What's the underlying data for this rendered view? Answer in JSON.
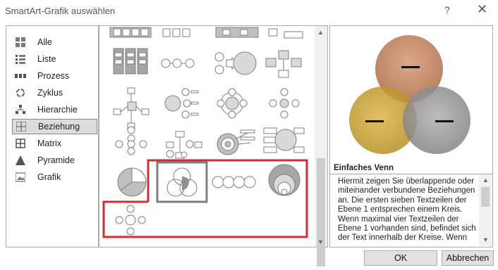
{
  "window": {
    "title": "SmartArt-Grafik auswählen",
    "help_icon": "?",
    "close_icon": "✕"
  },
  "categories": [
    {
      "label": "Alle",
      "icon": "all-icon",
      "selected": false
    },
    {
      "label": "Liste",
      "icon": "list-icon",
      "selected": false
    },
    {
      "label": "Prozess",
      "icon": "process-icon",
      "selected": false
    },
    {
      "label": "Zyklus",
      "icon": "cycle-icon",
      "selected": false
    },
    {
      "label": "Hierarchie",
      "icon": "hierarchy-icon",
      "selected": false
    },
    {
      "label": "Beziehung",
      "icon": "relationship-icon",
      "selected": true
    },
    {
      "label": "Matrix",
      "icon": "matrix-icon",
      "selected": false
    },
    {
      "label": "Pyramide",
      "icon": "pyramid-icon",
      "selected": false
    },
    {
      "label": "Grafik",
      "icon": "picture-icon",
      "selected": false
    }
  ],
  "preview": {
    "title": "Einfaches Venn",
    "description": "Hiermit zeigen Sie überlappende oder miteinander verbundene Beziehungen an. Die ersten sieben Textzeilen der Ebene 1 entsprechen einem Kreis. Wenn maximal vier Textzeilen der Ebene 1 vorhanden sind, befindet sich der Text innerhalb der Kreise. Wenn",
    "colors": {
      "top": "#c0805a",
      "left": "#c9a132",
      "right": "#9a9a9a"
    }
  },
  "buttons": {
    "ok": "OK",
    "cancel": "Abbrechen"
  },
  "highlight_color": "#d42b32"
}
